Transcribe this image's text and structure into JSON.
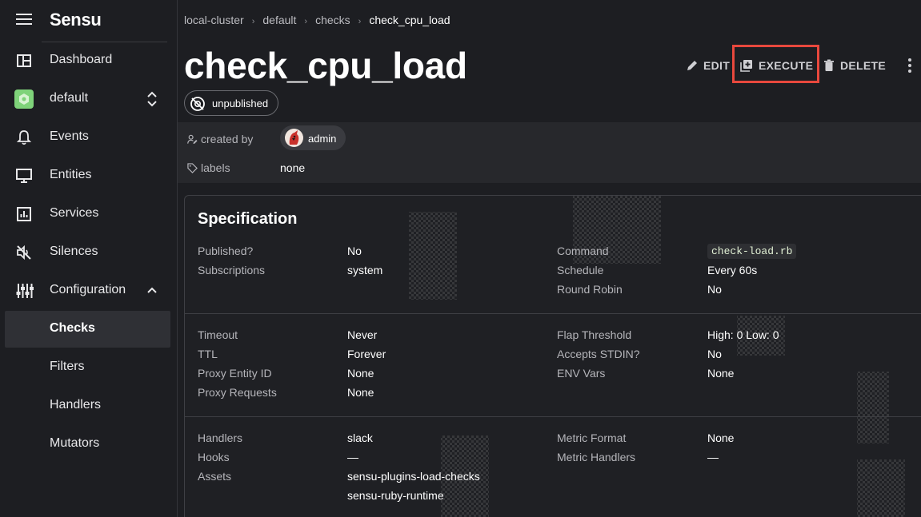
{
  "app": {
    "name": "Sensu"
  },
  "sidebar": {
    "items": [
      {
        "label": "Dashboard",
        "icon": "dashboard-icon"
      },
      {
        "label": "default",
        "icon": "namespace-icon"
      },
      {
        "label": "Events",
        "icon": "bell-icon"
      },
      {
        "label": "Entities",
        "icon": "monitor-icon"
      },
      {
        "label": "Services",
        "icon": "bar-chart-icon"
      },
      {
        "label": "Silences",
        "icon": "mute-icon"
      },
      {
        "label": "Configuration",
        "icon": "sliders-icon"
      },
      {
        "label": "Checks"
      },
      {
        "label": "Filters"
      },
      {
        "label": "Handlers"
      },
      {
        "label": "Mutators"
      }
    ]
  },
  "breadcrumb": {
    "cluster": "local-cluster",
    "namespace": "default",
    "section": "checks",
    "current": "check_cpu_load"
  },
  "page": {
    "title": "check_cpu_load"
  },
  "actions": {
    "edit": "EDIT",
    "execute": "EXECUTE",
    "delete": "DELETE"
  },
  "badge": {
    "label": "unpublished"
  },
  "meta": {
    "created_by_label": "created by",
    "created_by_value": "admin",
    "labels_label": "labels",
    "labels_value": "none"
  },
  "spec": {
    "title": "Specification",
    "published_label": "Published?",
    "published_value": "No",
    "subscriptions_label": "Subscriptions",
    "subscriptions_value": "system",
    "command_label": "Command",
    "command_value": "check-load.rb",
    "schedule_label": "Schedule",
    "schedule_value": "Every 60s",
    "round_robin_label": "Round Robin",
    "round_robin_value": "No",
    "timeout_label": "Timeout",
    "timeout_value": "Never",
    "ttl_label": "TTL",
    "ttl_value": "Forever",
    "proxy_entity_label": "Proxy Entity ID",
    "proxy_entity_value": "None",
    "proxy_requests_label": "Proxy Requests",
    "proxy_requests_value": "None",
    "flap_label": "Flap Threshold",
    "flap_value": "High: 0 Low: 0",
    "stdin_label": "Accepts STDIN?",
    "stdin_value": "No",
    "env_label": "ENV Vars",
    "env_value": "None",
    "handlers_label": "Handlers",
    "handlers_value": "slack",
    "hooks_label": "Hooks",
    "hooks_value": "—",
    "assets_label": "Assets",
    "assets_values": [
      "sensu-plugins-load-checks",
      "sensu-ruby-runtime"
    ],
    "metric_format_label": "Metric Format",
    "metric_format_value": "None",
    "metric_handlers_label": "Metric Handlers",
    "metric_handlers_value": "—"
  },
  "colors": {
    "background": "#1d1e22",
    "highlight": "#e8483d",
    "accent_namespace": "#7fd37a"
  }
}
